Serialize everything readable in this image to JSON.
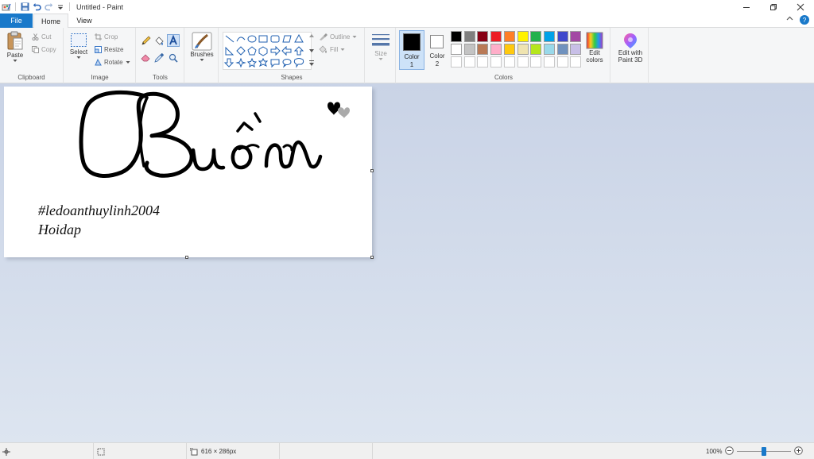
{
  "window": {
    "title": "Untitled - Paint"
  },
  "tabs": {
    "file": "File",
    "home": "Home",
    "view": "View"
  },
  "clipboard": {
    "label": "Clipboard",
    "paste": "Paste",
    "cut": "Cut",
    "copy": "Copy"
  },
  "image": {
    "label": "Image",
    "select": "Select",
    "crop": "Crop",
    "resize": "Resize",
    "rotate": "Rotate"
  },
  "tools": {
    "label": "Tools"
  },
  "brushes": {
    "label": "Brushes"
  },
  "shapes": {
    "label": "Shapes",
    "outline": "Outline",
    "fill": "Fill"
  },
  "size": {
    "label": "Size"
  },
  "color1": {
    "label": "Color",
    "num": "1",
    "value": "#000000"
  },
  "color2": {
    "label": "Color",
    "num": "2",
    "value": "#ffffff"
  },
  "colors": {
    "label": "Colors",
    "edit_label": "Edit",
    "edit_label2": "colors",
    "palette_row1": [
      "#000000",
      "#7f7f7f",
      "#880015",
      "#ed1c24",
      "#ff7f27",
      "#fff200",
      "#22b14c",
      "#00a2e8",
      "#3f48cc",
      "#a349a4"
    ],
    "palette_row2": [
      "#ffffff",
      "#c3c3c3",
      "#b97a57",
      "#ffaec9",
      "#ffc90e",
      "#efe4b0",
      "#b5e61d",
      "#99d9ea",
      "#7092be",
      "#c8bfe7"
    ]
  },
  "paint3d": {
    "line1": "Edit with",
    "line2": "Paint 3D"
  },
  "canvas": {
    "hashtag": "#ledoanthuylinh2004",
    "caption": "Hoidap"
  },
  "status": {
    "dimensions": "616 × 286px",
    "zoom": "100%"
  },
  "zoom_level": 0.5
}
